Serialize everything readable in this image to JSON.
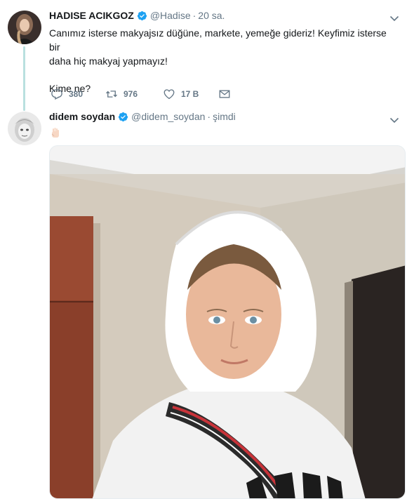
{
  "tweets": [
    {
      "fullname": "HADISE ACIKGOZ",
      "handle": "@Hadise",
      "separator": "·",
      "time": "20 sa.",
      "text_line1": "Canımız isterse makyajsız düğüne, markete, yemeğe gideriz! Keyfimiz isterse bir",
      "text_line2": "daha hiç makyaj yapmayız!",
      "text_line3": "Kime ne?",
      "reply_count": "380",
      "retweet_count": "976",
      "like_count": "17 B",
      "verified": true
    },
    {
      "fullname": "didem soydan",
      "handle": "@didem_soydan",
      "separator": "·",
      "time": "şimdi",
      "emoji": "raised-hand-emoji",
      "has_photo": true,
      "verified": true
    }
  ],
  "colors": {
    "accent": "#1da1f2",
    "thread_line": "#b9e0df",
    "secondary_text": "#657786",
    "primary_text": "#14171a"
  },
  "icons": [
    "verified-badge-icon",
    "chevron-down-icon",
    "reply-icon",
    "retweet-icon",
    "like-icon",
    "message-icon"
  ]
}
